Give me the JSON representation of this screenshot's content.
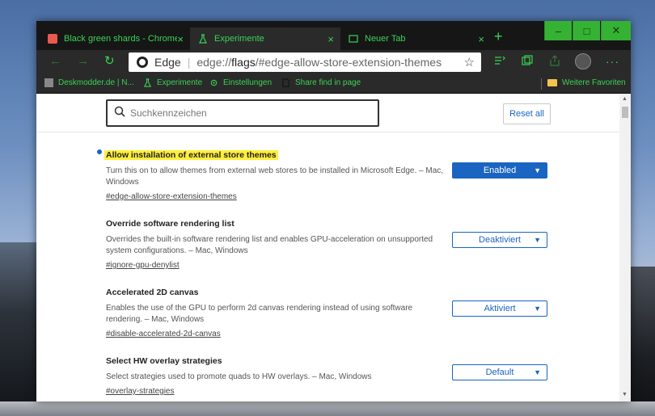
{
  "tabs": [
    {
      "label": "Black green shards - Chrome We",
      "close": "×"
    },
    {
      "label": "Experimente",
      "close": "×"
    },
    {
      "label": "Neuer Tab",
      "close": "×"
    }
  ],
  "new_tab": "+",
  "window_controls": {
    "minimize": "–",
    "maximize": "□",
    "close": "✕"
  },
  "nav": {
    "back": "←",
    "forward": "→",
    "refresh": "↻",
    "star": "☆"
  },
  "omnibox": {
    "brand": "Edge",
    "url_prefix": "edge://",
    "url_bold": "flags",
    "url_rest": "/#edge-allow-store-extension-themes"
  },
  "bookmarks": [
    {
      "label": "Deskmodder.de | N..."
    },
    {
      "label": "Experimente"
    },
    {
      "label": "Einstellungen"
    },
    {
      "label": "Share find in page"
    },
    {
      "label": "Weitere Favoriten"
    }
  ],
  "search": {
    "placeholder": "Suchkennzeichen"
  },
  "reset_label": "Reset all",
  "flags": [
    {
      "title": "Allow installation of external store themes",
      "description": "Turn this on to allow themes from external web stores to be installed in Microsoft Edge. – Mac, Windows",
      "id": "#edge-allow-store-extension-themes",
      "value": "Enabled"
    },
    {
      "title": "Override software rendering list",
      "description": "Overrides the built-in software rendering list and enables GPU-acceleration on unsupported system configurations. – Mac, Windows",
      "id": "#ignore-gpu-denylist",
      "value": "Deaktiviert"
    },
    {
      "title": "Accelerated 2D canvas",
      "description": "Enables the use of the GPU to perform 2d canvas rendering instead of using software rendering. – Mac, Windows",
      "id": "#disable-accelerated-2d-canvas",
      "value": "Aktiviert"
    },
    {
      "title": "Select HW overlay strategies",
      "description": "Select strategies used to promote quads to HW overlays. – Mac, Windows",
      "id": "#overlay-strategies",
      "value": "Default"
    }
  ],
  "colors": {
    "accent_green": "#39d353",
    "link_blue": "#1a64c2",
    "highlight": "#ffef3a"
  }
}
